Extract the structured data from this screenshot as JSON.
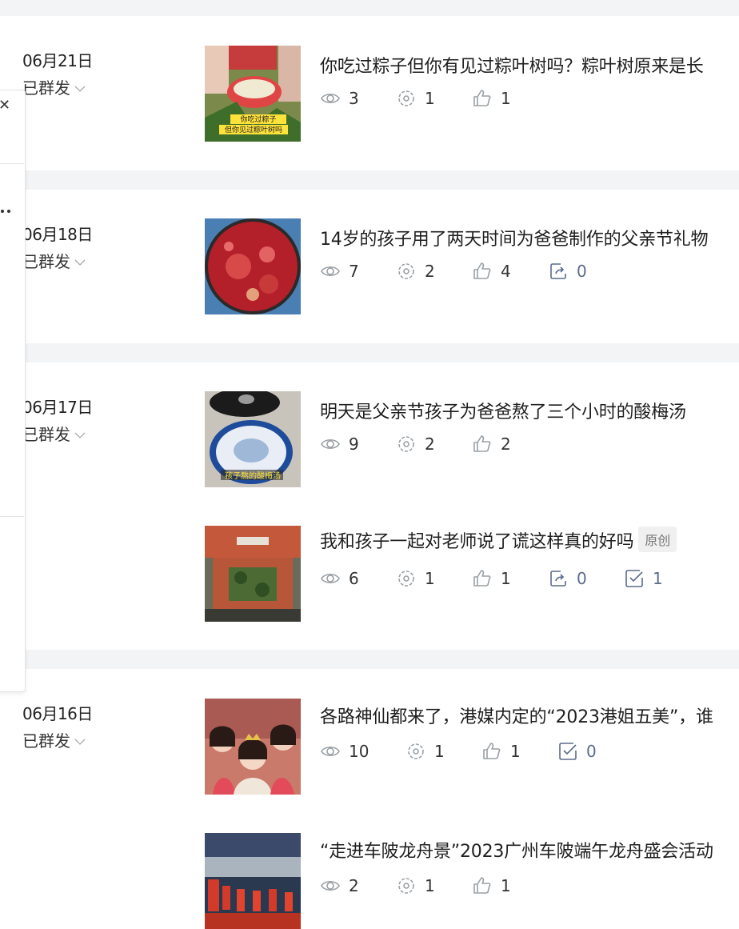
{
  "status_label": "已群发",
  "colors": {
    "gap": "#f3f4f6",
    "icon": "#9aa0a6",
    "blue_icon": "#5b6b8c"
  },
  "groups": [
    {
      "date": "06月21日",
      "articles": [
        {
          "title": "你吃过粽子但你有见过粽叶树吗？粽叶树原来是长",
          "thumb_caption": [
            "你吃过粽子",
            "但你见过粽叶树吗"
          ],
          "views": "3",
          "shares": "1",
          "likes": "1"
        }
      ]
    },
    {
      "date": "06月18日",
      "articles": [
        {
          "title": "14岁的孩子用了两天时间为爸爸制作的父亲节礼物",
          "views": "7",
          "shares": "2",
          "likes": "4",
          "forwards": "0"
        }
      ]
    },
    {
      "date": "06月17日",
      "articles": [
        {
          "title": "明天是父亲节孩子为爸爸熬了三个小时的酸梅汤",
          "thumb_caption": [
            "孩子熬的酸梅汤"
          ],
          "views": "9",
          "shares": "2",
          "likes": "2"
        },
        {
          "title": "我和孩子一起对老师说了谎这样真的好吗",
          "badge": "原创",
          "views": "6",
          "shares": "1",
          "likes": "1",
          "forwards": "0",
          "checks": "1"
        }
      ]
    },
    {
      "date": "06月16日",
      "articles": [
        {
          "title": "各路神仙都来了，港媒内定的“2023港姐五美”，谁",
          "views": "10",
          "shares": "1",
          "likes": "1",
          "checks": "0"
        },
        {
          "title": "“走进车陂龙舟景”2023广州车陂端午龙舟盛会活动",
          "views": "2",
          "shares": "1",
          "likes": "1"
        }
      ]
    }
  ],
  "popup": {
    "close_icon": "close-icon",
    "more_icon": "more-icon"
  }
}
